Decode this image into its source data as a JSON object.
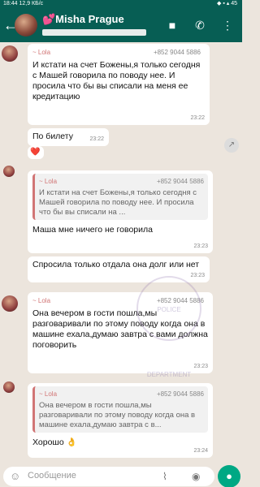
{
  "status": {
    "time": "18:44",
    "speed": "12,9 КБ/с",
    "right": "◆ ▪ ▴ 45"
  },
  "header": {
    "name": "💕Misha Prague"
  },
  "messages": {
    "m1": {
      "quote_name": "~ Lola",
      "quote_phone": "+852 9044 5886",
      "text": "И кстати на счет Божены,я только сегодня с Машей говорила по поводу нее. И просила что бы вы списали на меня ее кредитацию",
      "time": "23:22"
    },
    "m2": {
      "text": "По билету",
      "time": "23:22"
    },
    "m3": {
      "reaction": "❤️"
    },
    "m4": {
      "quote_name": "~ Lola",
      "quote_phone": "+852 9044 5886",
      "quote_text": "И кстати на счет Божены,я только сегодня с Машей говорила по поводу нее. И просила что бы вы списали на ...",
      "text": "Маша мне ничего не говорила",
      "time": "23:23"
    },
    "m5": {
      "text": "Спросила только отдала она долг или нет",
      "time": "23:23"
    },
    "m6": {
      "quote_name": "~ Lola",
      "quote_phone": "+852 9044 5886",
      "text": "Она вечером в гости пошла,мы разговаривали по этому поводу когда она в машине ехала,думаю завтра с вами должна поговорить",
      "time": "23:23"
    },
    "m7": {
      "quote_name": "~ Lola",
      "quote_phone": "+852 9044 5886",
      "quote_text": "Она вечером в гости пошла,мы разговаривали по этому поводу когда она в машине ехала,думаю завтра с в...",
      "text": "Хорошо 👌",
      "time": "23:24"
    }
  },
  "input": {
    "placeholder": "Сообщение"
  },
  "watermark": {
    "text": "POLICE DEPARTMENT"
  }
}
